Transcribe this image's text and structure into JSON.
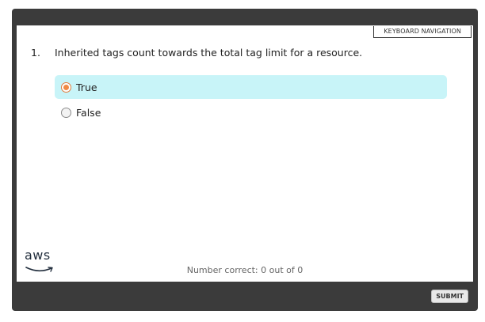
{
  "toolbar": {
    "keyboard_navigation": "KEYBOARD NAVIGATION"
  },
  "question": {
    "number": "1.",
    "text": "Inherited tags count towards the total tag limit for a resource."
  },
  "options": [
    {
      "label": "True",
      "selected": true
    },
    {
      "label": "False",
      "selected": false
    }
  ],
  "branding": {
    "logo_text": "aws",
    "logo_icon": "aws-smile-icon"
  },
  "footer": {
    "score_text": "Number correct: 0 out of 0",
    "submit_label": "SUBMIT"
  },
  "colors": {
    "frame": "#3b3b3b",
    "selected_option_bg": "#c8f4f8",
    "radio_checked": "#f08a45",
    "aws_smile": "#f90"
  }
}
